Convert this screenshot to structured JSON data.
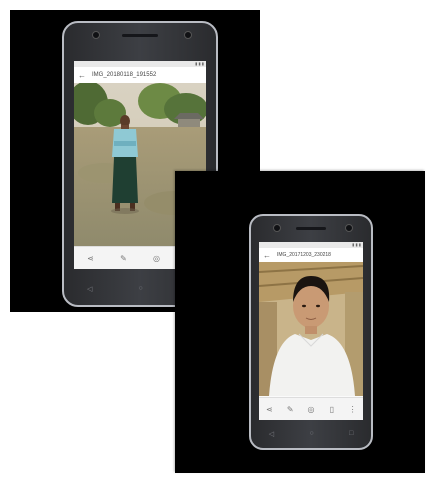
{
  "photos": [
    {
      "filename": "IMG_20180118_191552",
      "subject": "standing-man"
    },
    {
      "filename": "IMG_20171203_230218",
      "subject": "portrait"
    }
  ],
  "actions": [
    "share-icon",
    "edit-icon",
    "tools-icon",
    "delete-icon"
  ],
  "colors": {
    "frame": "#000000",
    "phone_trim": "#b9bcc3",
    "screen": "#fafafa"
  }
}
